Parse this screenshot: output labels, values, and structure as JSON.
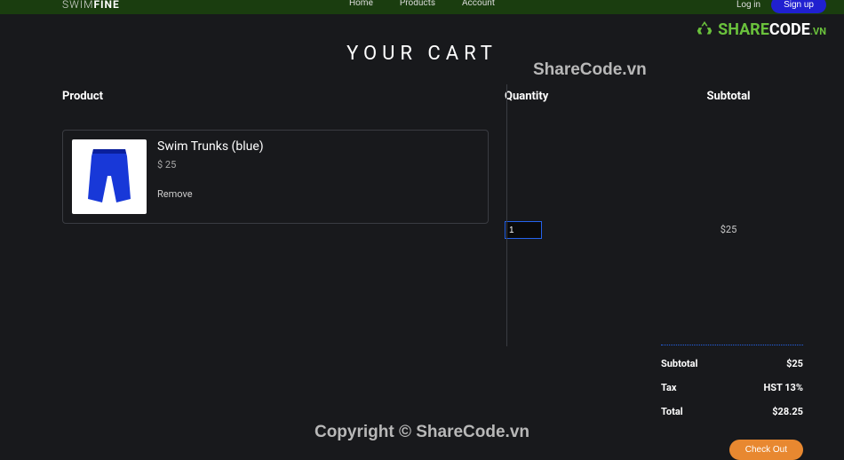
{
  "header": {
    "logo_thin": "SWIM",
    "logo_bold": "FINE",
    "nav": [
      "Home",
      "Products",
      "Account"
    ],
    "login": "Log in",
    "signup": "Sign up"
  },
  "watermark": {
    "share": "SHARE",
    "code": "CODE",
    "vn": ".VN",
    "text2": "ShareCode.vn",
    "copyright": "Copyright © ShareCode.vn"
  },
  "cart": {
    "title": "YOUR CART",
    "headers": {
      "product": "Product",
      "quantity": "Quantity",
      "subtotal": "Subtotal"
    },
    "item": {
      "name": "Swim Trunks (blue)",
      "price": "$ 25",
      "remove": "Remove",
      "qty": "1",
      "subtotal": "$25"
    },
    "summary": {
      "subtotal_label": "Subtotal",
      "subtotal_value": "$25",
      "tax_label": "Tax",
      "tax_value": "HST 13%",
      "total_label": "Total",
      "total_value": "$28.25"
    },
    "checkout": "Check Out"
  }
}
